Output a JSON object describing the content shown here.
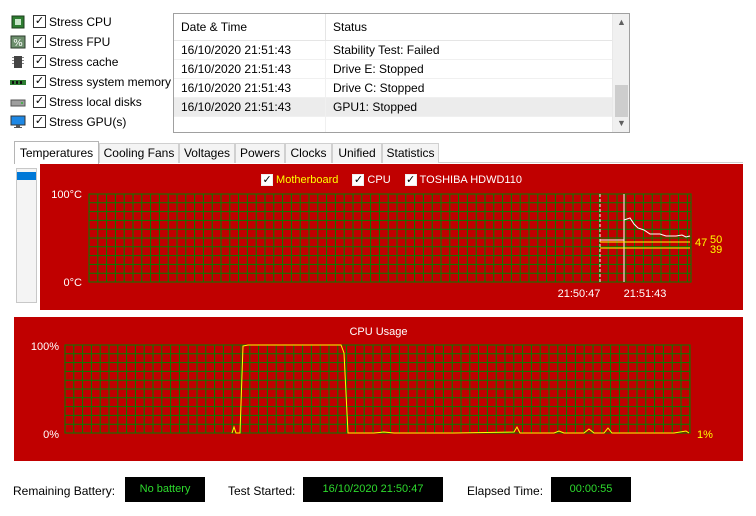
{
  "stress_options": [
    {
      "label": "Stress CPU",
      "checked": true,
      "icon": "cpu-chip-icon"
    },
    {
      "label": "Stress FPU",
      "checked": true,
      "icon": "fpu-percent-icon"
    },
    {
      "label": "Stress cache",
      "checked": true,
      "icon": "cache-memory-icon"
    },
    {
      "label": "Stress system memory",
      "checked": true,
      "icon": "ram-module-icon"
    },
    {
      "label": "Stress local disks",
      "checked": true,
      "icon": "hard-disk-icon"
    },
    {
      "label": "Stress GPU(s)",
      "checked": true,
      "icon": "monitor-gpu-icon"
    }
  ],
  "log": {
    "headers": {
      "datetime": "Date & Time",
      "status": "Status"
    },
    "rows": [
      {
        "datetime": "16/10/2020 21:51:43",
        "status": "Stability Test: Failed"
      },
      {
        "datetime": "16/10/2020 21:51:43",
        "status": "Drive E: Stopped"
      },
      {
        "datetime": "16/10/2020 21:51:43",
        "status": "Drive C: Stopped"
      },
      {
        "datetime": "16/10/2020 21:51:43",
        "status": "GPU1: Stopped"
      }
    ]
  },
  "tabs": [
    "Temperatures",
    "Cooling Fans",
    "Voltages",
    "Powers",
    "Clocks",
    "Unified",
    "Statistics"
  ],
  "temperature_chart": {
    "legend": [
      {
        "label": "Motherboard",
        "color": "#ffff00",
        "checked": true
      },
      {
        "label": "CPU",
        "color": "#ffffff",
        "checked": true
      },
      {
        "label": "TOSHIBA HDWD110",
        "color": "#ffffff",
        "checked": true
      }
    ],
    "y_top_label": "100°C",
    "y_bottom_label": "0°C",
    "x_labels": [
      "21:50:47",
      "21:51:43"
    ],
    "readouts": [
      "50",
      "47",
      "39"
    ]
  },
  "cpu_chart": {
    "title": "CPU Usage",
    "y_top_label": "100%",
    "y_bottom_label": "0%",
    "readout": "1%"
  },
  "colors": {
    "chart_bg": "#c00000",
    "grid": "#008000",
    "yellow_line": "#ffff00",
    "white_line": "#ffffff",
    "status_text": "#2ddb2d"
  },
  "status": {
    "battery_label": "Remaining Battery:",
    "battery_value": "No battery",
    "started_label": "Test Started:",
    "started_value": "16/10/2020 21:50:47",
    "elapsed_label": "Elapsed Time:",
    "elapsed_value": "00:00:55"
  }
}
